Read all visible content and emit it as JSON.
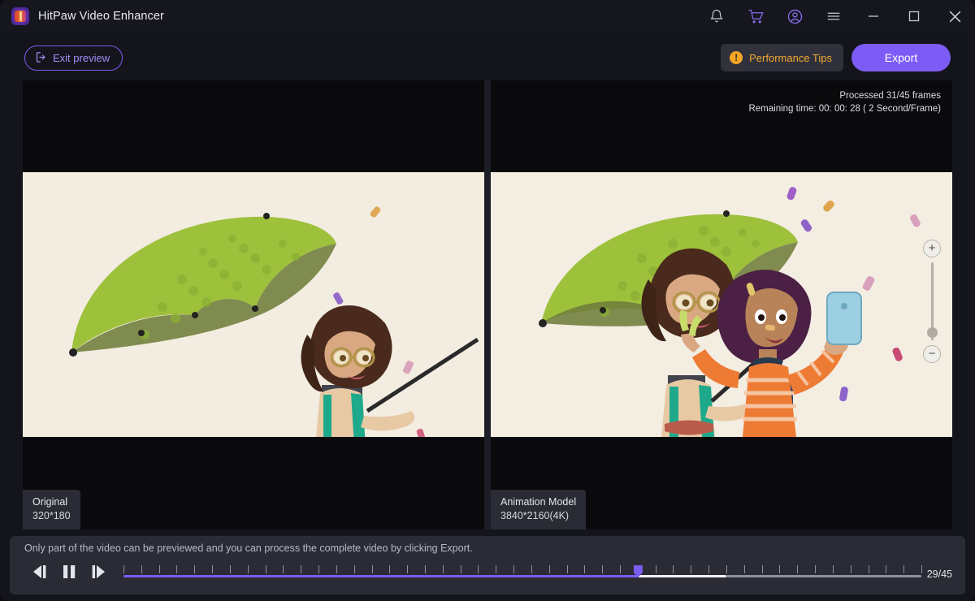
{
  "window": {
    "app_title": "HitPaw Video Enhancer",
    "logo_icon": "hitpaw-logo-icon",
    "controls": [
      {
        "name": "notifications-bell-icon",
        "label": "Notifications"
      },
      {
        "name": "shopping-cart-icon",
        "label": "Store"
      },
      {
        "name": "user-account-icon",
        "label": "Account"
      },
      {
        "name": "hamburger-menu-icon",
        "label": "Menu"
      },
      {
        "name": "minimize-icon",
        "label": "Minimize"
      },
      {
        "name": "maximize-icon",
        "label": "Maximize"
      },
      {
        "name": "close-icon",
        "label": "Close"
      }
    ]
  },
  "toolbar": {
    "exit_preview_label": "Exit preview",
    "exit_preview_icon": "exit-door-arrow-icon",
    "performance_tips_label": "Performance Tips",
    "performance_tips_icon": "warning-exclamation-icon",
    "performance_tips_badge": "!",
    "export_label": "Export"
  },
  "preview": {
    "status_line_1": "Processed 31/45 frames",
    "status_line_2": "Remaining time: 00: 00: 28 ( 2 Second/Frame)",
    "left_pane": {
      "tag_title": "Original",
      "tag_resolution": "320*180"
    },
    "right_pane": {
      "tag_title": "Animation Model",
      "tag_resolution": "3840*2160(4K)"
    },
    "zoom_controls": {
      "zoom_in_label": "+",
      "zoom_out_label": "−"
    }
  },
  "bottom": {
    "hint": "Only part of the video can be previewed and you can process the complete video by clicking Export.",
    "prev_frame_icon": "previous-frame-icon",
    "pause_icon": "pause-icon",
    "next_frame_icon": "next-frame-icon",
    "frame_counter": "29/45",
    "current_frame": 29,
    "total_frames": 45,
    "buffered_frame": 34
  },
  "colors": {
    "accent_purple": "#7c5cf5",
    "warning_orange": "#f5a623",
    "window_bg": "#14141c",
    "panel_bg": "#1d1d27",
    "bottom_bar_bg": "#2b2b36",
    "canvas_cream": "#f2ece1"
  }
}
